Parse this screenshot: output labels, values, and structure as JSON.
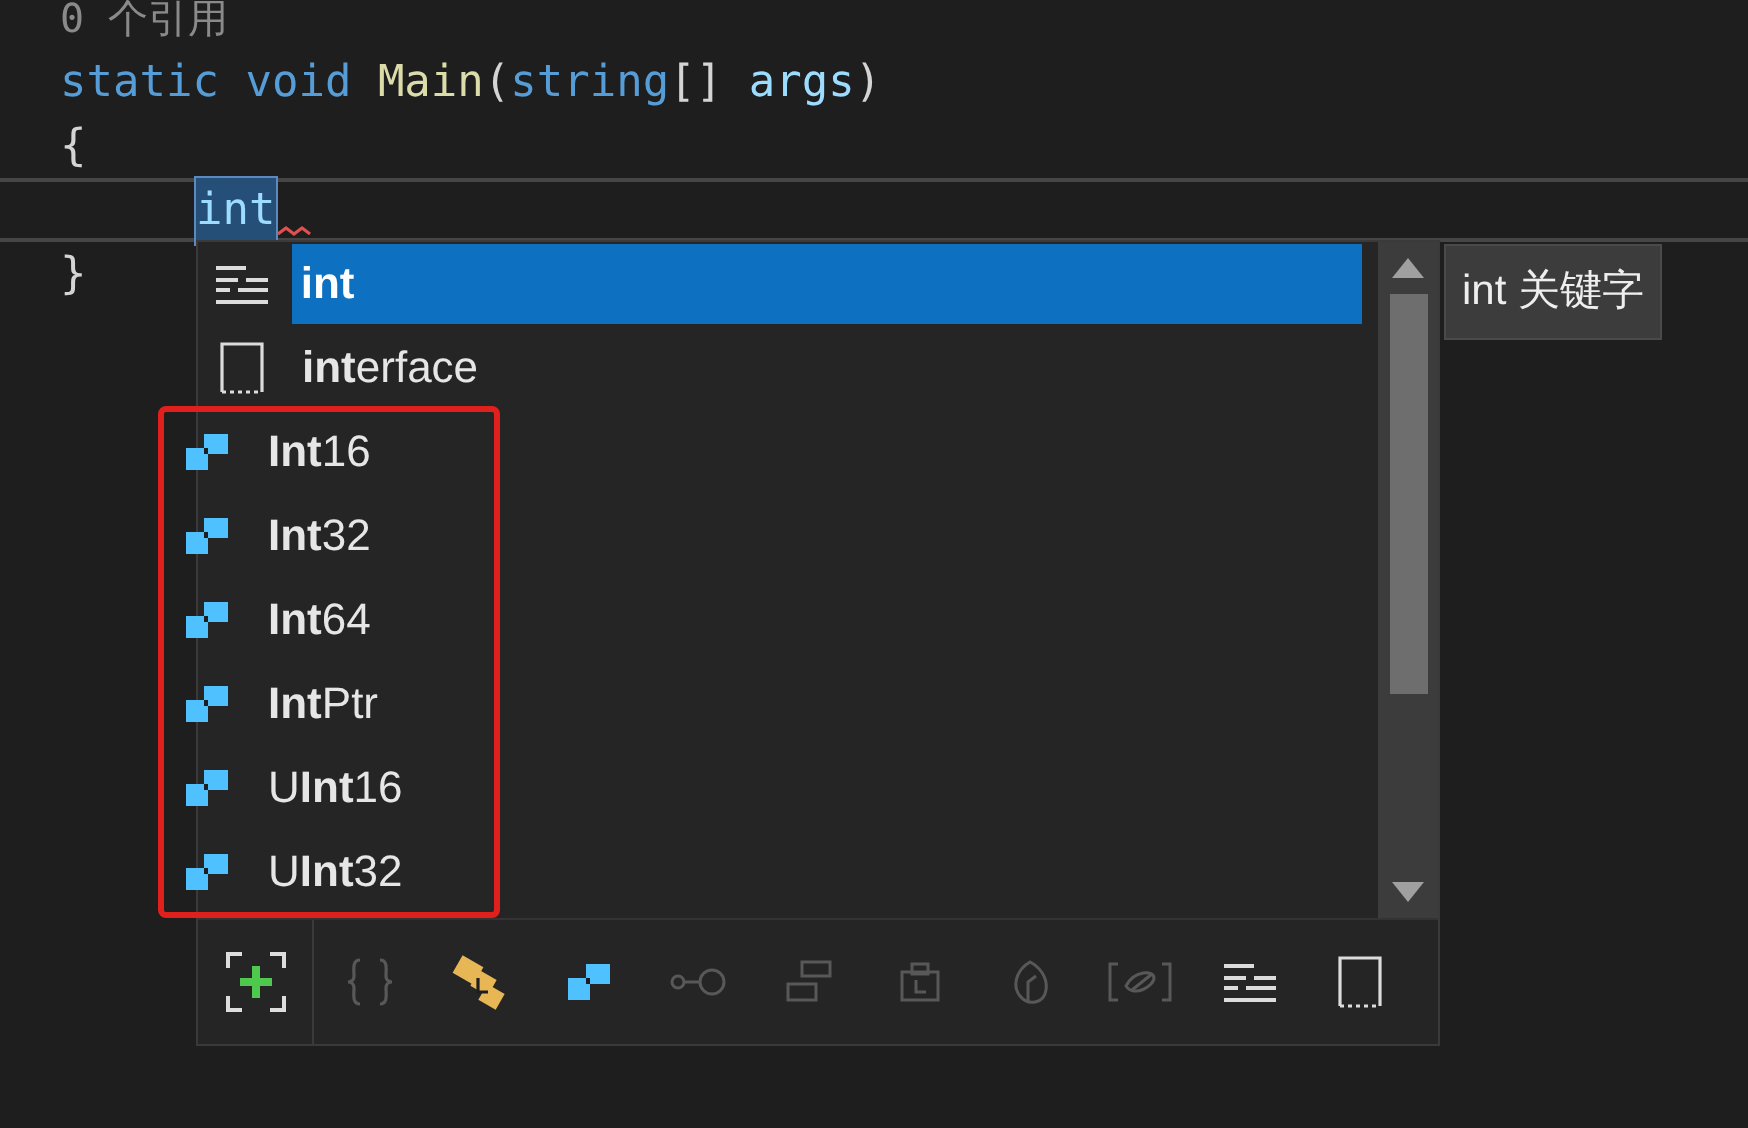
{
  "code_lines": [
    {
      "kind": "codelens",
      "tokens": [
        {
          "kind": "comment",
          "text": "0 个引用"
        }
      ]
    },
    {
      "kind": "code",
      "tokens": [
        {
          "kind": "keyword",
          "text": "static"
        },
        {
          "kind": "keyword",
          "text": "void",
          "space_before": true
        },
        {
          "kind": "method",
          "text": "Main",
          "space_before": true
        },
        {
          "kind": "plain",
          "text": "("
        },
        {
          "kind": "keyword",
          "text": "string"
        },
        {
          "kind": "plain",
          "text": "[]"
        },
        {
          "kind": "param",
          "text": "args",
          "space_before": true
        },
        {
          "kind": "plain",
          "text": ")"
        }
      ]
    },
    {
      "kind": "code",
      "tokens": [
        {
          "kind": "plain",
          "text": "{"
        }
      ]
    },
    {
      "kind": "current",
      "tokens": [
        {
          "kind": "typed",
          "text": "int"
        }
      ]
    },
    {
      "kind": "code",
      "tokens": [
        {
          "kind": "plain",
          "text": "}"
        }
      ]
    }
  ],
  "completion": {
    "items": [
      {
        "kind": "keyword",
        "label": "**int**",
        "selected": true,
        "highlighted": false
      },
      {
        "kind": "snippet",
        "label": "**int**erface",
        "selected": false,
        "highlighted": false
      },
      {
        "kind": "struct",
        "label": "**Int**16",
        "selected": false,
        "highlighted": true
      },
      {
        "kind": "struct",
        "label": "**Int**32",
        "selected": false,
        "highlighted": true
      },
      {
        "kind": "struct",
        "label": "**Int**64",
        "selected": false,
        "highlighted": true
      },
      {
        "kind": "struct",
        "label": "**Int**Ptr",
        "selected": false,
        "highlighted": true
      },
      {
        "kind": "struct",
        "label": "U**Int**16",
        "selected": false,
        "highlighted": true
      },
      {
        "kind": "struct",
        "label": "U**Int**32",
        "selected": false,
        "highlighted": true
      }
    ],
    "filters": [
      {
        "kind": "namespace",
        "enabled": false
      },
      {
        "kind": "class",
        "enabled": true
      },
      {
        "kind": "struct",
        "enabled": true
      },
      {
        "kind": "interface",
        "enabled": false
      },
      {
        "kind": "enum",
        "enabled": false
      },
      {
        "kind": "delegate",
        "enabled": false
      },
      {
        "kind": "module",
        "enabled": false
      },
      {
        "kind": "extension",
        "enabled": false
      },
      {
        "kind": "keyword",
        "enabled": true
      },
      {
        "kind": "snippet",
        "enabled": true
      }
    ],
    "tooltip": "int 关键字"
  }
}
